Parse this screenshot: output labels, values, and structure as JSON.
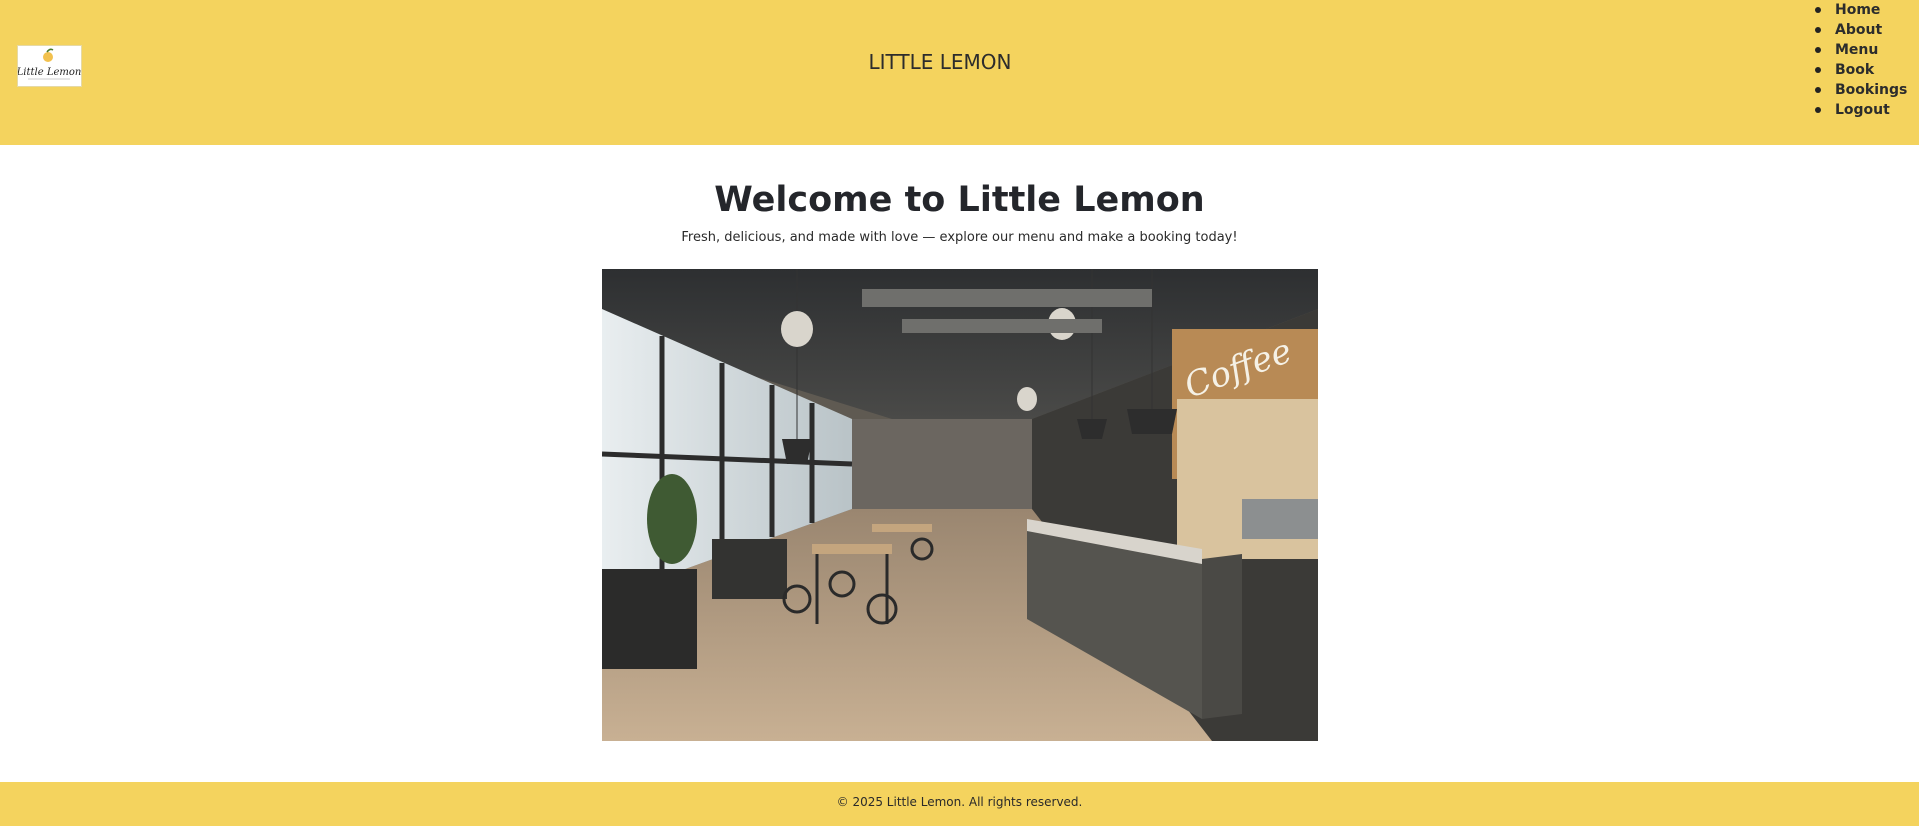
{
  "header": {
    "logo_text": "Little Lemon",
    "site_title": "LITTLE LEMON",
    "nav": [
      {
        "label": "Home"
      },
      {
        "label": "About"
      },
      {
        "label": "Menu"
      },
      {
        "label": "Book"
      },
      {
        "label": "Bookings"
      },
      {
        "label": "Logout"
      }
    ]
  },
  "main": {
    "heading": "Welcome to Little Lemon",
    "subtitle": "Fresh, delicious, and made with love — explore our menu and make a booking today!",
    "hero_sign": "Coffee"
  },
  "footer": {
    "copyright": "© 2025 Little Lemon. All rights reserved."
  },
  "colors": {
    "brand_yellow": "#f4d35e",
    "text_dark": "#24262b"
  }
}
